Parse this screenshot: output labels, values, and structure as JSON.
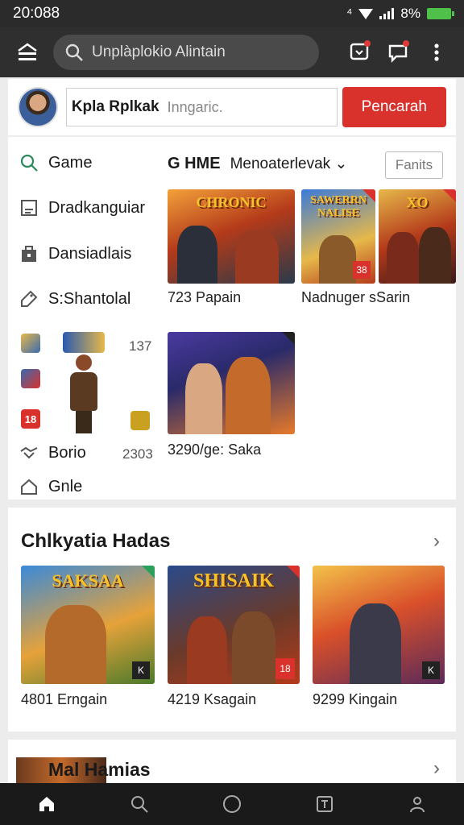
{
  "status_bar": {
    "time": "20:088",
    "battery_text": "8%",
    "extra": "⁴"
  },
  "app_bar": {
    "search_placeholder": "Unplàplokio Alintain"
  },
  "profile": {
    "name": "Kpla Rplkak",
    "hint": "Inngaric.",
    "button_label": "Pencarah"
  },
  "sidebar": {
    "items": [
      {
        "label": "Game",
        "icon": "search-icon"
      },
      {
        "label": "Dradkanguiar",
        "icon": "document-icon"
      },
      {
        "label": "Dansiadlais",
        "icon": "bag-icon"
      },
      {
        "label": "S:Shantolal",
        "icon": "tag-icon"
      },
      {
        "label": "Borio",
        "icon": "handshake-icon"
      },
      {
        "label": "Gnle",
        "icon": "house-icon"
      }
    ],
    "num_1": "137",
    "num_2": "2303",
    "mini_badge": "18"
  },
  "main": {
    "head_strong": "G HME",
    "head_dropdown": "Menoaterlevak",
    "filter_label": "Fanits",
    "tiles": [
      {
        "art": "CHRONIC",
        "caption": "723 Papain"
      },
      {
        "art": "SAWERRN NALISE",
        "caption": "Nadnuger sSarin",
        "badge": "38"
      },
      {
        "art": "XO",
        "caption": ""
      },
      {
        "art": "",
        "caption": "3290/ge: Saka"
      }
    ]
  },
  "section2": {
    "title": "Chlkyatia Hadas",
    "tiles": [
      {
        "art": "SAKSAA",
        "caption": "4801 Erngain"
      },
      {
        "art": "SHISAIK",
        "caption": "4219 Ksagain",
        "badge": "18"
      },
      {
        "art": "",
        "caption": "9299 Kingain"
      }
    ]
  },
  "section3": {
    "title": "Mal Hamias"
  },
  "colors": {
    "primary_red": "#d9322c",
    "app_bar": "#2f2f2f",
    "status_bar": "#2b2b2b",
    "nav_bar": "#1a1a1a"
  }
}
